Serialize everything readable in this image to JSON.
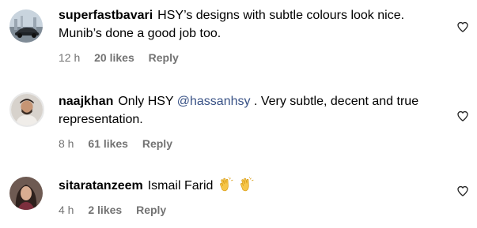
{
  "comments": [
    {
      "username": "superfastbavari",
      "text": "HSY’s designs with subtle colours look nice. Munib’s done a good job too.",
      "time": "12 h",
      "likes": "20 likes",
      "reply": "Reply",
      "heart_icon": "heart-outline-icon"
    },
    {
      "username": "naajkhan",
      "text_before": "Only HSY",
      "mention": "@hassanhsy",
      "text_after": ". Very subtle, decent and true representation.",
      "time": "8 h",
      "likes": "61 likes",
      "reply": "Reply",
      "heart_icon": "heart-outline-icon"
    },
    {
      "username": "sitaratanzeem",
      "text": "Ismail Farid",
      "emojis": [
        "clapping-hands-emoji",
        "clapping-hands-emoji"
      ],
      "time": "4 h",
      "likes": "2 likes",
      "reply": "Reply",
      "heart_icon": "heart-outline-icon"
    }
  ],
  "colors": {
    "meta_text": "#737373",
    "mention": "#385185"
  }
}
